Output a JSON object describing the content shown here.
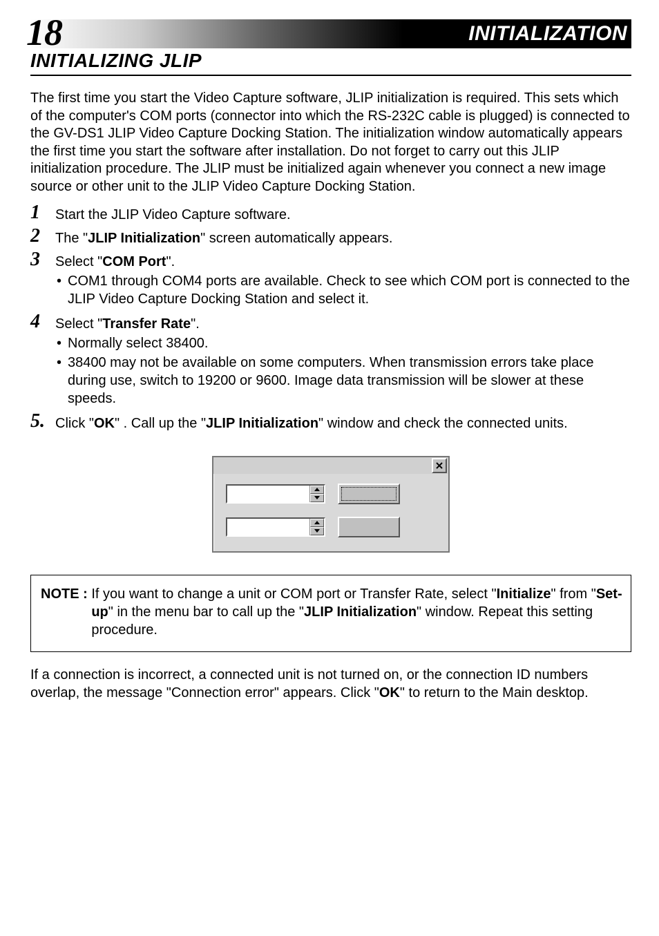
{
  "header": {
    "page_number": "18",
    "title": "INITIALIZATION"
  },
  "section": {
    "title": "INITIALIZING  JLIP",
    "intro": "The first time you start the Video Capture software, JLIP initialization is required. This sets which of the computer's  COM ports (connector into which the RS-232C cable is plugged) is connected to the GV-DS1 JLIP Video Capture Docking Station.  The initialization window automatically appears the first time you start the software after installation. Do not forget to carry out this JLIP initialization procedure.  The JLIP must be initialized again whenever you connect a new image source or other unit to the JLIP Video Capture Docking Station."
  },
  "steps": [
    {
      "num": "1",
      "text_plain": "Start the JLIP Video Capture software."
    },
    {
      "num": "2",
      "text_pre": "The \"",
      "text_bold": "JLIP Initialization",
      "text_post": "\" screen automatically appears."
    },
    {
      "num": "3",
      "text_pre": "Select \"",
      "text_bold": "COM Port",
      "text_post": "\".",
      "bullets": [
        "COM1 through COM4 ports are available. Check to see which COM port is connected to the JLIP Video Capture Docking Station and select it."
      ]
    },
    {
      "num": "4",
      "text_pre": "Select \"",
      "text_bold": "Transfer Rate",
      "text_post": "\".",
      "bullets": [
        "Normally select 38400.",
        "38400 may not be available on some computers.  When transmission errors take place during use, switch to 19200 or 9600.  Image data transmission will be slower at these speeds."
      ]
    },
    {
      "num": "5.",
      "seg1_pre": "Click \"",
      "seg1_bold": "OK",
      "seg1_mid": "\" .  Call up the \"",
      "seg2_bold": "JLIP Initialization",
      "seg2_post": "\" window and check the connected units."
    }
  ],
  "dialog": {
    "close_icon": "close",
    "combo1_name": "com-port-select",
    "combo2_name": "transfer-rate-select",
    "ok_button_name": "ok-button",
    "cancel_button_name": "cancel-button"
  },
  "note": {
    "label": "NOTE : ",
    "pre": "If you want to change a unit or COM port or Transfer Rate, select \"",
    "b1": "Initialize",
    "mid1": "\" from \"",
    "b2": "Set-up",
    "mid2": "\" in the menu bar to call up the \"",
    "b3": "JLIP Initialization",
    "post": "\" window. Repeat this setting procedure."
  },
  "outro": {
    "pre": "If a connection is incorrect, a connected unit is not turned on, or the connection ID numbers overlap, the message \"Connection error\" appears.  Click \"",
    "bold": "OK",
    "post": "\" to return to the Main desktop."
  }
}
